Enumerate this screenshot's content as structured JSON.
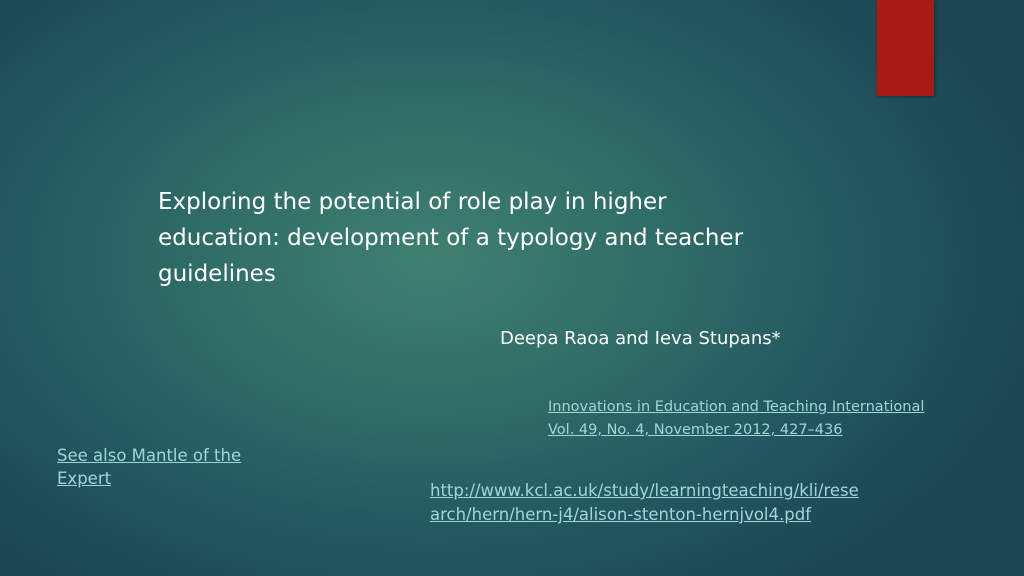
{
  "slide": {
    "title_lines": [
      "Exploring the potential of role play in higher",
      "education: development of a typology and teacher",
      "guidelines"
    ],
    "authors": "Deepa Raoa and Ieva Stupans*",
    "citation_lines": [
      "Innovations in Education and Teaching International",
      "Vol. 49, No. 4, November 2012, 427–436"
    ],
    "see_also_lines": [
      "See also Mantle of the",
      "Expert"
    ],
    "url_lines": [
      "http://www.kcl.ac.uk/study/learningteaching/kli/rese",
      "arch/hern/hern-j4/alison-stenton-hernjvol4.pdf"
    ]
  },
  "colors": {
    "background_center": "#3f8070",
    "background_edge": "#1b4753",
    "accent_tab": "#a61b17",
    "link": "#9fd7d6",
    "text": "#ffffff"
  }
}
